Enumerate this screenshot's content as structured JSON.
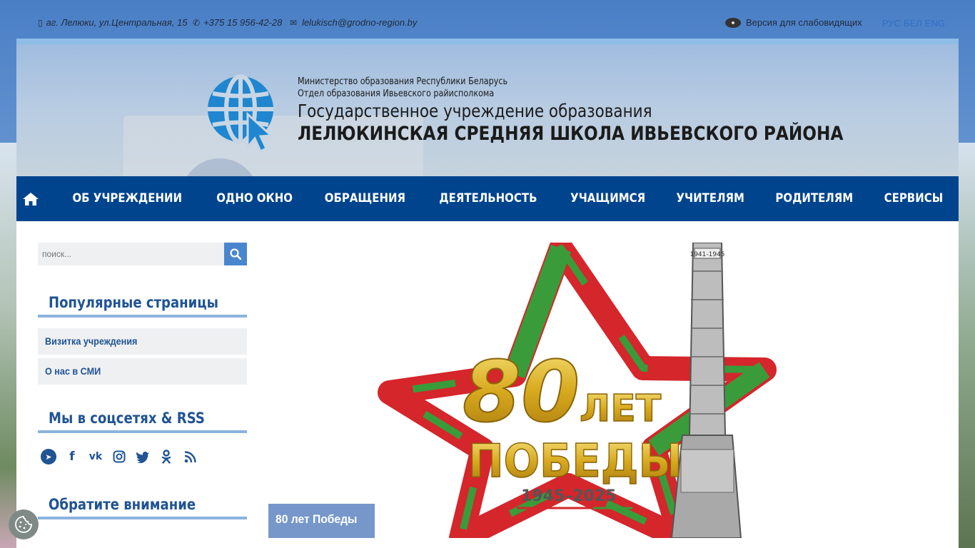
{
  "topbar": {
    "address": "аг. Лелюки, ул.Центральная, 15",
    "phone": "+375 15 956-42-28",
    "email": "lelukisch@grodno-region.by",
    "vision_label": "Версия для слабовидящих",
    "languages": [
      "РУС",
      "БЕЛ",
      "ENG"
    ]
  },
  "header": {
    "ministry": "Министерство образования Республики Беларусь",
    "department": "Отдел образования Ивьевского райисполкома",
    "institution_type": "Государственное учреждение образования",
    "school_name": "ЛЕЛЮКИНСКАЯ СРЕДНЯЯ ШКОЛА ИВЬЕВСКОГО РАЙОНА"
  },
  "nav": {
    "items": [
      "ОБ УЧРЕЖДЕНИИ",
      "ОДНО ОКНО",
      "ОБРАЩЕНИЯ",
      "ДЕЯТЕЛЬНОСТЬ",
      "УЧАЩИМСЯ",
      "УЧИТЕЛЯМ",
      "РОДИТЕЛЯМ",
      "СЕРВИСЫ"
    ]
  },
  "sidebar": {
    "search_placeholder": "поиск...",
    "popular_title": "Популярные страницы",
    "popular_items": [
      "Визитка учреждения",
      "О нас в СМИ"
    ],
    "social_title": "Мы в соцсетях & RSS",
    "social_icons": [
      "telegram-icon",
      "facebook-icon",
      "vk-icon",
      "instagram-icon",
      "twitter-icon",
      "odnoklassniki-icon",
      "rss-icon"
    ],
    "attention_title": "Обратите внимание"
  },
  "banner": {
    "caption": "80 лет Победы",
    "emblem_number": "80",
    "emblem_word1": "ЛЕТ",
    "emblem_word2": "ПОБЕДЫ",
    "emblem_years": "1945–2025",
    "obelisk_label": "1941-1945"
  },
  "colors": {
    "nav_bg": "#00448e",
    "accent": "#205493",
    "caption_bg": "#6489c4"
  }
}
